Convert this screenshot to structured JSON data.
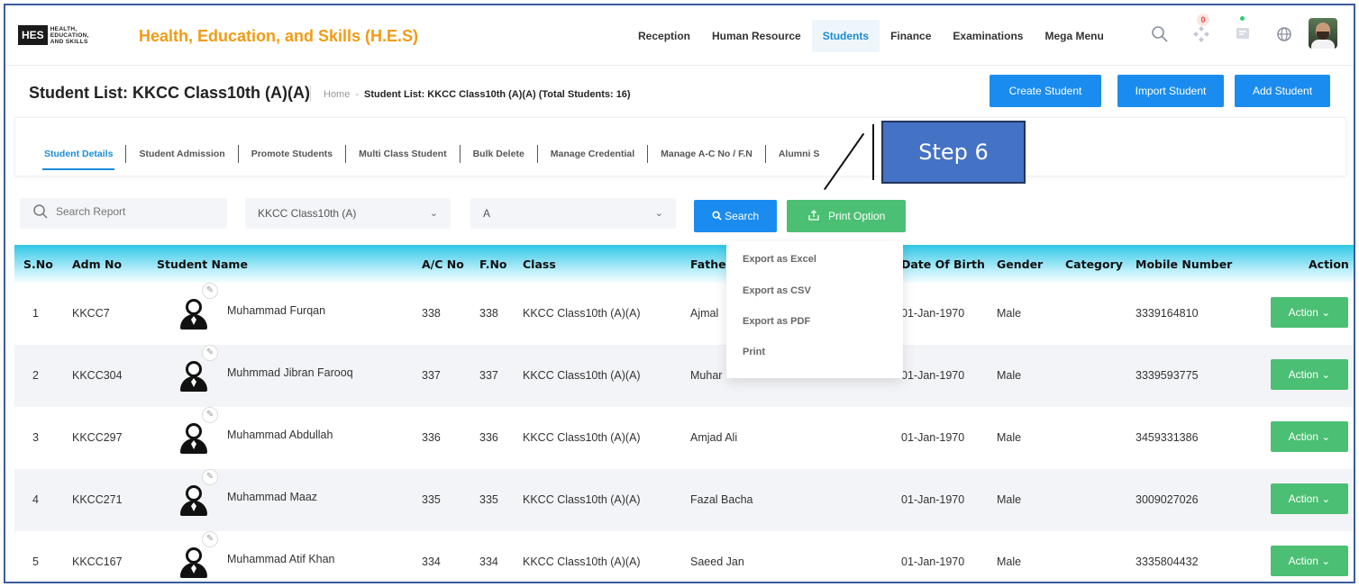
{
  "app": {
    "logo_abbr": "HES",
    "logo_tag": [
      "HEALTH,",
      "EDUCATION,",
      "AND SKILLS"
    ],
    "brand": "Health, Education, and Skills (H.E.S)"
  },
  "nav": {
    "items": [
      {
        "label": "Reception"
      },
      {
        "label": "Human Resource"
      },
      {
        "label": "Students",
        "active": true
      },
      {
        "label": "Finance"
      },
      {
        "label": "Examinations"
      },
      {
        "label": "Mega Menu"
      }
    ],
    "notif_count": "0"
  },
  "header": {
    "title": "Student List: KKCC Class10th (A)(A)",
    "breadcrumb_home": "Home",
    "breadcrumb_dash": "-",
    "breadcrumb_current": "Student List: KKCC Class10th (A)(A) (Total Students: 16)",
    "buttons": {
      "create": "Create Student",
      "import": "Import Student",
      "add": "Add Student"
    }
  },
  "tabs": [
    "Student Details",
    "Student Admission",
    "Promote Students",
    "Multi Class Student",
    "Bulk Delete",
    "Manage Credential",
    "Manage A-C No / F.N",
    "Alumni S"
  ],
  "annotation": {
    "step_label": "Step 6"
  },
  "filters": {
    "search_placeholder": "Search Report",
    "class_value": "KKCC Class10th (A)",
    "section_value": "A",
    "search_button": "Search",
    "print_button": "Print Option"
  },
  "print_menu": [
    "Export as Excel",
    "Export as CSV",
    "Export as PDF",
    "Print"
  ],
  "table": {
    "headers": {
      "sno": "S.No",
      "adm": "Adm No",
      "name": "Student Name",
      "ac": "A/C No",
      "fno": "F.No",
      "class": "Class",
      "father": "Fathe",
      "dob": "Date Of Birth",
      "gender": "Gender",
      "category": "Category",
      "mobile": "Mobile Number",
      "action": "Action"
    },
    "action_label": "Action ⌄",
    "rows": [
      {
        "sno": "1",
        "adm": "KKCC7",
        "name": "Muhammad Furqan",
        "ac": "338",
        "fno": "338",
        "class": "KKCC Class10th (A)(A)",
        "father": "Ajmal",
        "dob": "01-Jan-1970",
        "gender": "Male",
        "category": "",
        "mobile": "3339164810"
      },
      {
        "sno": "2",
        "adm": "KKCC304",
        "name": "Muhmmad Jibran Farooq",
        "ac": "337",
        "fno": "337",
        "class": "KKCC Class10th (A)(A)",
        "father": "Muhar",
        "dob": "01-Jan-1970",
        "gender": "Male",
        "category": "",
        "mobile": "3339593775"
      },
      {
        "sno": "3",
        "adm": "KKCC297",
        "name": "Muhammad Abdullah",
        "ac": "336",
        "fno": "336",
        "class": "KKCC Class10th (A)(A)",
        "father": "Amjad Ali",
        "dob": "01-Jan-1970",
        "gender": "Male",
        "category": "",
        "mobile": "3459331386"
      },
      {
        "sno": "4",
        "adm": "KKCC271",
        "name": "Muhammad Maaz",
        "ac": "335",
        "fno": "335",
        "class": "KKCC Class10th (A)(A)",
        "father": "Fazal Bacha",
        "dob": "01-Jan-1970",
        "gender": "Male",
        "category": "",
        "mobile": "3009027026"
      },
      {
        "sno": "5",
        "adm": "KKCC167",
        "name": "Muhammad Atif Khan",
        "ac": "334",
        "fno": "334",
        "class": "KKCC Class10th (A)(A)",
        "father": "Saeed Jan",
        "dob": "01-Jan-1970",
        "gender": "Male",
        "category": "",
        "mobile": "3335804432"
      }
    ]
  },
  "colors": {
    "brand": "#f29b14",
    "primary": "#1a8cf0",
    "success": "#4bbf73",
    "annotation": "#4472c4"
  },
  "icons": [
    "search-icon",
    "apps-icon",
    "chat-icon",
    "globe-icon",
    "upload-icon",
    "edit-icon",
    "student-avatar-icon",
    "chevron-down-icon"
  ]
}
